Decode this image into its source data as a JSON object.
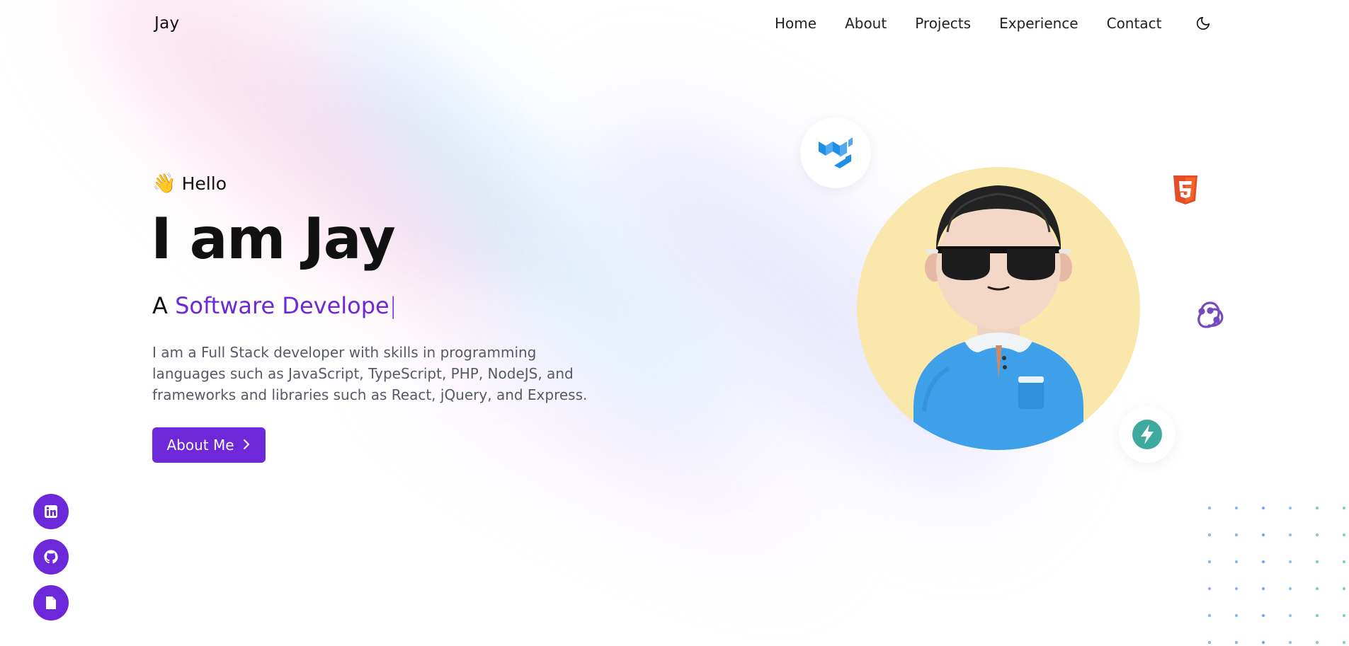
{
  "nav": {
    "logo": "Jay",
    "items": [
      "Home",
      "About",
      "Projects",
      "Experience",
      "Contact"
    ],
    "theme_toggle_icon": "moon-icon"
  },
  "hero": {
    "greeting_emoji": "👋",
    "greeting": "Hello",
    "title": "I am Jay",
    "subtitle_prefix": "A",
    "subtitle_role": "Software Develope",
    "caret": "|",
    "description": "I am a Full Stack developer with skills in programming languages such as JavaScript, TypeScript, PHP, NodeJS, and frameworks and libraries such as React, jQuery, and Express.",
    "cta_label": "About Me",
    "cta_icon": "chevron-right-icon"
  },
  "tech_icons": [
    "mui-icon",
    "html5-icon",
    "redux-icon",
    "vite-icon"
  ],
  "socials": [
    "linkedin-icon",
    "github-icon",
    "document-icon"
  ],
  "colors": {
    "accent": "#6d28d9",
    "avatar_bg": "#fae7ac",
    "html5": "#e44d26",
    "mui": "#1f8fe6",
    "redux": "#764abc",
    "vite": "#3ea99f"
  }
}
